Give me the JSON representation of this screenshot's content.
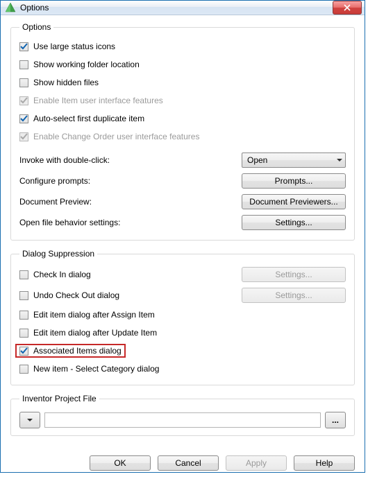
{
  "window": {
    "title": "Options"
  },
  "options": {
    "legend": "Options",
    "large_icons_label": "Use large status icons",
    "show_working_folder_label": "Show working folder location",
    "show_hidden_label": "Show hidden files",
    "enable_item_ui_label": "Enable Item user interface features",
    "auto_select_dup_label": "Auto-select first duplicate item",
    "enable_co_ui_label": "Enable Change Order user interface features",
    "invoke_label": "Invoke with double-click:",
    "invoke_value": "Open",
    "configure_prompts_label": "Configure prompts:",
    "prompts_btn": "Prompts...",
    "doc_preview_label": "Document Preview:",
    "doc_preview_btn": "Document Previewers...",
    "open_file_label": "Open file behavior settings:",
    "open_file_btn": "Settings..."
  },
  "suppression": {
    "legend": "Dialog Suppression",
    "checkin_label": "Check In dialog",
    "undo_checkout_label": "Undo Check Out dialog",
    "edit_after_assign_label": "Edit item dialog after Assign Item",
    "edit_after_update_label": "Edit item dialog after Update Item",
    "associated_items_label": "Associated Items dialog",
    "new_item_category_label": "New item - Select Category dialog",
    "settings_btn": "Settings..."
  },
  "project": {
    "legend": "Inventor Project File",
    "path": "",
    "browse_label": "..."
  },
  "footer": {
    "ok": "OK",
    "cancel": "Cancel",
    "apply": "Apply",
    "help": "Help"
  }
}
